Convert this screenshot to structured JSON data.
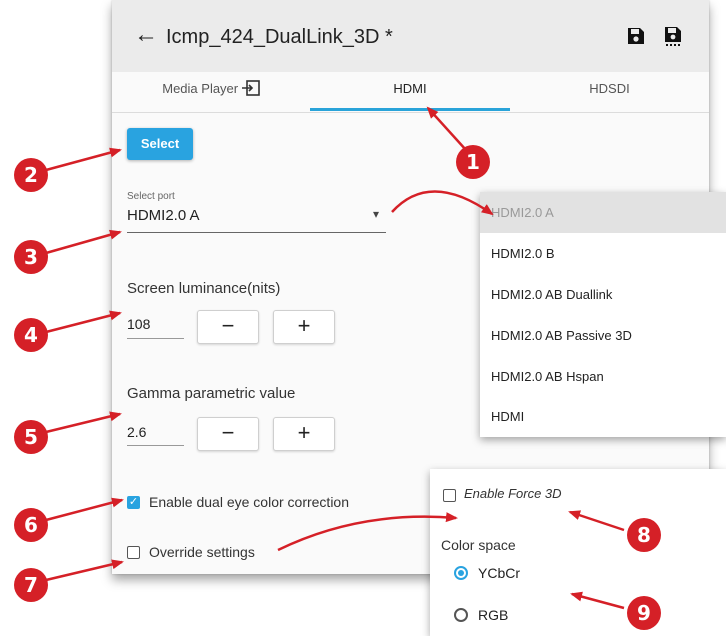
{
  "header": {
    "back_glyph": "←",
    "title": "Icmp_424_DualLink_3D *",
    "save_icon": "save-icon",
    "save_as_icon": "save-as-icon"
  },
  "tabs": [
    {
      "label": "Media Player",
      "icon": "import-icon"
    },
    {
      "label": "HDMI"
    },
    {
      "label": "HDSDI"
    }
  ],
  "select_button": {
    "label": "Select"
  },
  "port": {
    "label": "Select port",
    "value": "HDMI2.0 A",
    "arrow": "▾"
  },
  "luminance": {
    "label": "Screen luminance(nits)",
    "value": "108",
    "minus": "−",
    "plus": "+"
  },
  "gamma": {
    "label": "Gamma parametric value",
    "value": "2.6",
    "minus": "−",
    "plus": "+"
  },
  "dual_eye": {
    "label": "Enable dual eye color correction",
    "checked": true,
    "check_glyph": "✓"
  },
  "override": {
    "label": "Override settings",
    "checked": false
  },
  "dropdown_options": [
    "HDMI2.0 A",
    "HDMI2.0 B",
    "HDMI2.0 AB Duallink",
    "HDMI2.0 AB Passive 3D",
    "HDMI2.0 AB Hspan",
    "HDMI"
  ],
  "force3d": {
    "label": "Enable Force 3D",
    "checked": false
  },
  "color_space": {
    "label": "Color space",
    "options": [
      "YCbCr",
      "RGB"
    ],
    "selected": "YCbCr"
  },
  "callouts": [
    "1",
    "2",
    "3",
    "4",
    "5",
    "6",
    "7",
    "8",
    "9"
  ],
  "colors": {
    "accent": "#29a3e0",
    "callout": "#d52027"
  }
}
